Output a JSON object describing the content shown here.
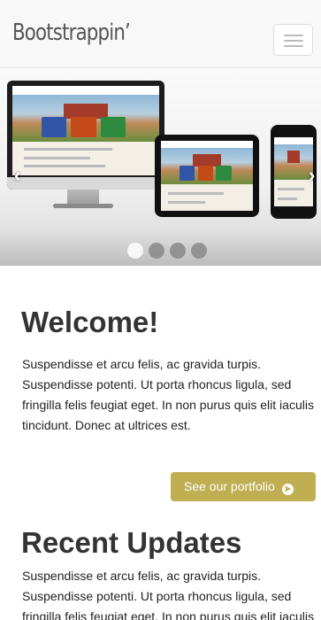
{
  "navbar": {
    "brand": "Bootstrappin’",
    "menu_icon": "hamburger-menu-icon"
  },
  "carousel": {
    "slide_count": 4,
    "active_slide": 1,
    "prev_icon": "chevron-left-icon",
    "next_icon": "chevron-right-icon"
  },
  "welcome": {
    "title": "Welcome!",
    "body": "Suspendisse et arcu felis, ac gravida turpis. Suspendisse potenti. Ut porta rhoncus ligula, sed fringilla felis feugiat eget. In non purus quis elit iaculis tincidunt. Donec at ultrices est.",
    "button_label": "See our portfolio",
    "button_icon": "circle-arrow-right-icon"
  },
  "updates": {
    "title": "Recent Updates",
    "body": "Suspendisse et arcu felis, ac gravida turpis. Suspendisse potenti. Ut porta rhoncus ligula, sed fringilla felis feugiat eget. In non purus quis elit iaculis tincidunt. Donec at ultrices est."
  },
  "colors": {
    "button": "#bfae52",
    "navbar_bg": "#f8f8f8",
    "heading": "#333333"
  }
}
